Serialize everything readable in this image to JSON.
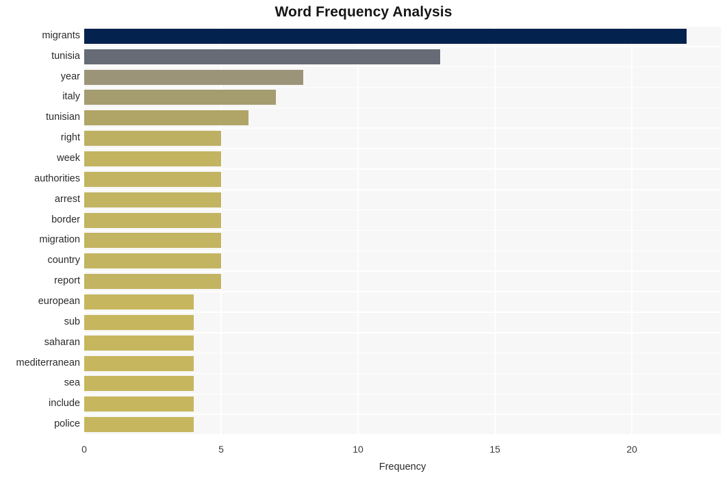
{
  "chart_data": {
    "type": "bar",
    "orientation": "horizontal",
    "title": "Word Frequency Analysis",
    "xlabel": "Frequency",
    "ylabel": "",
    "xlim": [
      0,
      23.25
    ],
    "xticks": [
      0,
      5,
      10,
      15,
      20
    ],
    "xtick_labels": [
      "0",
      "5",
      "10",
      "15",
      "20"
    ],
    "grid": true,
    "legend": "none",
    "categories": [
      "migrants",
      "tunisia",
      "year",
      "italy",
      "tunisian",
      "right",
      "week",
      "authorities",
      "arrest",
      "border",
      "migration",
      "country",
      "report",
      "european",
      "sub",
      "saharan",
      "mediterranean",
      "sea",
      "include",
      "police"
    ],
    "values": [
      22,
      13,
      8,
      7,
      6,
      5,
      5,
      5,
      5,
      5,
      5,
      5,
      5,
      4,
      4,
      4,
      4,
      4,
      4,
      4
    ],
    "bar_colors": [
      "#04224e",
      "#666b76",
      "#9c9479",
      "#a59c70",
      "#b0a566",
      "#bdb062",
      "#c2b461",
      "#c2b461",
      "#c2b461",
      "#c2b461",
      "#c2b461",
      "#c2b461",
      "#c2b461",
      "#c6b75f",
      "#c6b75f",
      "#c6b75f",
      "#c6b75f",
      "#c6b75f",
      "#c6b75f",
      "#c6b75f"
    ],
    "plot_background": "#f7f7f7",
    "gridline_color": "#ffffff",
    "figure_background": "#ffffff",
    "title_color": "#161616"
  }
}
